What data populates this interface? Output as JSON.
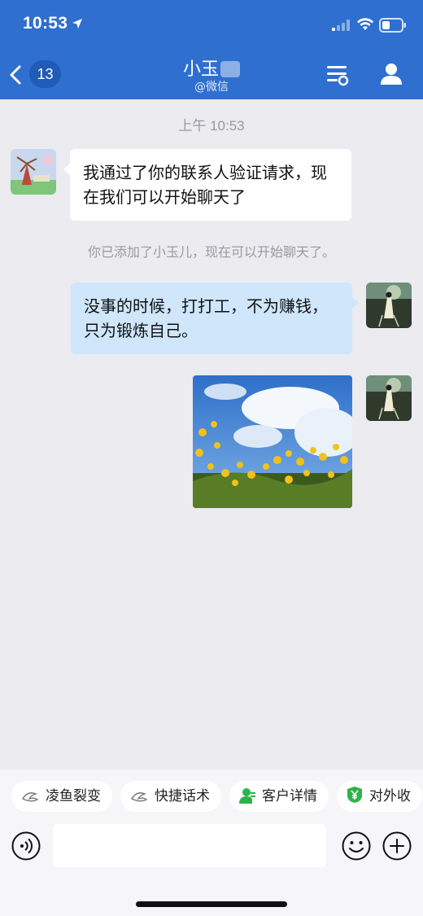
{
  "status_bar": {
    "time": "10:53"
  },
  "header": {
    "back_badge": "13",
    "title": "小玉",
    "subtitle": "@微信"
  },
  "chat": {
    "timestamp": "上午 10:53",
    "messages": [
      {
        "side": "left",
        "text": "我通过了你的联系人验证请求，现在我们可以开始聊天了"
      },
      {
        "side": "system",
        "text": "你已添加了小玉儿，现在可以开始聊天了。"
      },
      {
        "side": "right",
        "text": "没事的时候，打打工，不为赚钱，只为锻炼自己。"
      },
      {
        "side": "right",
        "type": "image"
      }
    ]
  },
  "quick_actions": [
    {
      "label": "凌鱼裂变",
      "icon": "fish-icon"
    },
    {
      "label": "快捷话术",
      "icon": "fish-icon"
    },
    {
      "label": "客户详情",
      "icon": "customer-icon"
    },
    {
      "label": "对外收",
      "icon": "yuan-icon"
    }
  ],
  "input": {
    "placeholder": ""
  },
  "colors": {
    "header_bg": "#2f6fd0",
    "chat_bg": "#ebebf0",
    "outgoing_bubble": "#cfe6fb",
    "incoming_bubble": "#ffffff",
    "green_accent": "#2db34a"
  }
}
